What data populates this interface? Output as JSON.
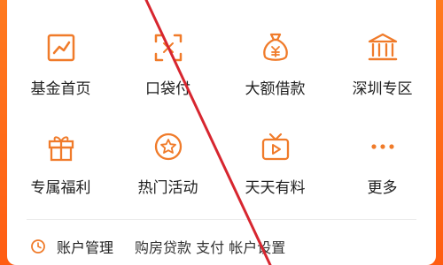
{
  "colors": {
    "accent": "#f07b2a",
    "background": "#ff6f1c",
    "annotation": "#d7262f"
  },
  "services": [
    {
      "id": "fund",
      "label": "基金首页",
      "icon": "line-chart-icon"
    },
    {
      "id": "pocket",
      "label": "口袋付",
      "icon": "scan-icon"
    },
    {
      "id": "loan",
      "label": "大额借款",
      "icon": "money-bag-icon"
    },
    {
      "id": "shenzhen",
      "label": "深圳专区",
      "icon": "bank-icon"
    },
    {
      "id": "welfare",
      "label": "专属福利",
      "icon": "gift-icon"
    },
    {
      "id": "events",
      "label": "热门活动",
      "icon": "star-badge-icon"
    },
    {
      "id": "daily",
      "label": "天天有料",
      "icon": "tv-play-icon"
    },
    {
      "id": "more",
      "label": "更多",
      "icon": "more-dots-icon"
    }
  ],
  "bottom_bar": {
    "account_label": "账户管理",
    "partial_text": "购房贷款 支付 帐户设置"
  }
}
